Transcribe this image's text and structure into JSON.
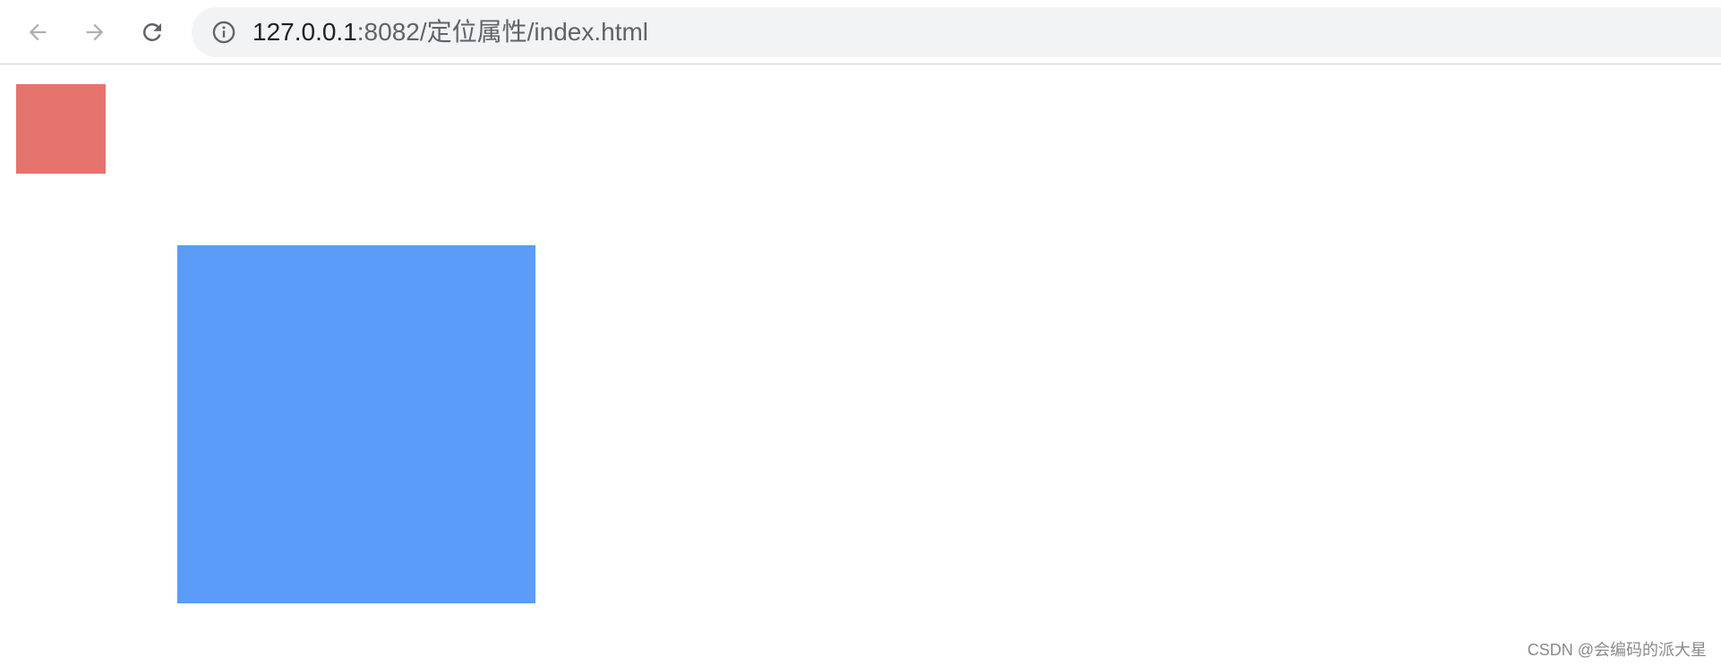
{
  "browser": {
    "url_host": "127.0.0.1",
    "url_rest": ":8082/定位属性/index.html",
    "icons": {
      "back": "arrow-left-icon",
      "forward": "arrow-right-icon",
      "reload": "reload-icon",
      "site_info": "info-icon"
    }
  },
  "page": {
    "red_box_color": "#e5746f",
    "blue_box_color": "#5b9cf8"
  },
  "watermark": "CSDN @会编码的派大星"
}
